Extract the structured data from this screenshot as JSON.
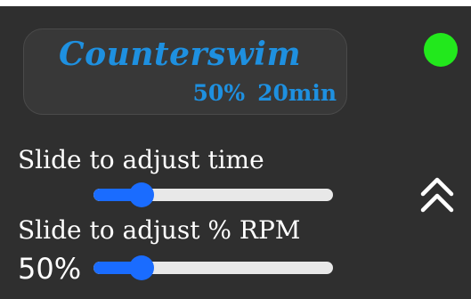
{
  "colors": {
    "background": "#2f2f2f",
    "accent": "#1e90e0",
    "slider_blue": "#1a6cff",
    "track": "#e8e8e8",
    "status_green": "#22e81c",
    "text": "#ffffff"
  },
  "mode_card": {
    "title": "Counterswim",
    "rpm_percent": "50%",
    "duration": "20min"
  },
  "status_indicator": {
    "state": "active"
  },
  "time_slider": {
    "label": "Slide to adjust time",
    "level": 0.2
  },
  "rpm_slider": {
    "label": "Slide to adjust % RPM",
    "readout": "50%",
    "level": 0.2
  },
  "collapse_button": {
    "icon": "double-chevron-up-icon"
  }
}
